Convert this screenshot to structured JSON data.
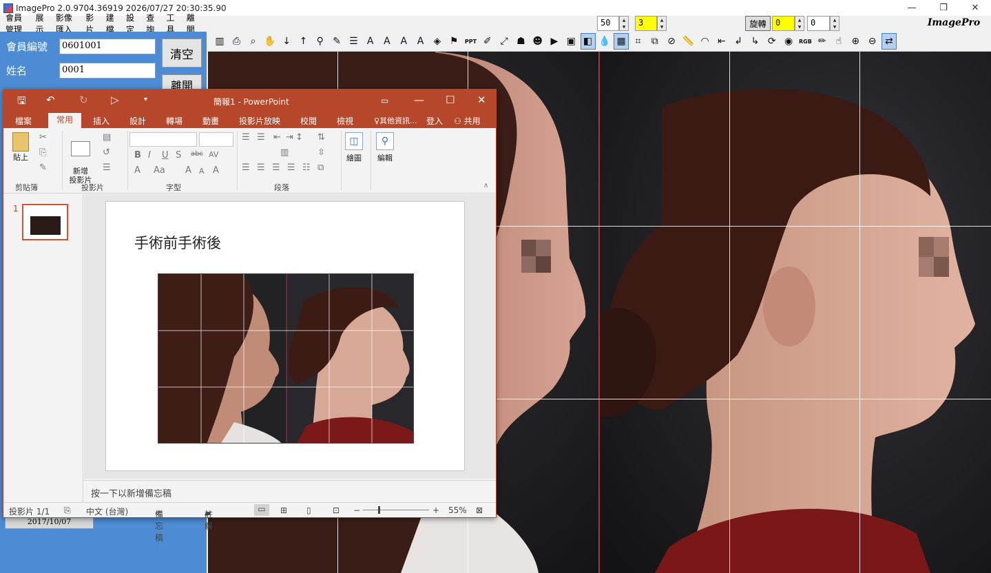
{
  "window": {
    "title": "ImagePro 2.0.9704.36919 2026/07/27 20:30:35.90",
    "minimize": "—",
    "restore": "❐",
    "close": "✕"
  },
  "menu": [
    "會員管理",
    "展示",
    "影像匯入",
    "影片",
    "建檔",
    "設定",
    "查詢",
    "工具",
    "離開"
  ],
  "controls": {
    "value_a": "50",
    "value_b": "3",
    "rotate_label": "旋轉",
    "rotate_value": "0",
    "value_c": "0",
    "brand": "ImagePro",
    "spin_up": "▲",
    "spin_down": "▼"
  },
  "toolbar": [
    {
      "icon": "layout-icon",
      "glyph": "▥"
    },
    {
      "icon": "export-icon",
      "glyph": "⎙"
    },
    {
      "icon": "ai-search-icon",
      "glyph": "⌕"
    },
    {
      "icon": "hand-icon",
      "glyph": "✋"
    },
    {
      "icon": "arrow-down-icon",
      "glyph": "↓"
    },
    {
      "icon": "arrow-up-icon",
      "glyph": "↑"
    },
    {
      "icon": "zoom-icon",
      "glyph": "⚲"
    },
    {
      "icon": "pen-icon",
      "glyph": "✎"
    },
    {
      "icon": "line-weight-icon",
      "glyph": "☰"
    },
    {
      "icon": "text-icon",
      "glyph": "A"
    },
    {
      "icon": "text-outline-icon",
      "glyph": "A"
    },
    {
      "icon": "text-search-icon",
      "glyph": "A"
    },
    {
      "icon": "underline-text-icon",
      "glyph": "A"
    },
    {
      "icon": "fill-icon",
      "glyph": "◈"
    },
    {
      "icon": "stamp-icon",
      "glyph": "⚑"
    },
    {
      "icon": "ppt-icon",
      "glyph": "PPT",
      "small": true
    },
    {
      "icon": "edit-doc-icon",
      "glyph": "✐"
    },
    {
      "icon": "fullscreen-icon",
      "glyph": "⤢"
    },
    {
      "icon": "portrait-icon",
      "glyph": "☗"
    },
    {
      "icon": "person-icon",
      "glyph": "☻"
    },
    {
      "icon": "play-icon",
      "glyph": "▶"
    },
    {
      "icon": "save-icon",
      "glyph": "▣"
    },
    {
      "icon": "compare-icon",
      "glyph": "◧",
      "selected": true
    },
    {
      "icon": "drop-icon",
      "glyph": "💧"
    },
    {
      "icon": "grid-icon",
      "glyph": "▦",
      "selected": true
    },
    {
      "icon": "crop-icon",
      "glyph": "⌗"
    },
    {
      "icon": "layers-icon",
      "glyph": "⧉"
    },
    {
      "icon": "cancel-icon",
      "glyph": "⊘"
    },
    {
      "icon": "ruler-icon",
      "glyph": "📏"
    },
    {
      "icon": "protractor-icon",
      "glyph": "◠"
    },
    {
      "icon": "back-icon",
      "glyph": "⇤"
    },
    {
      "icon": "turn-left-icon",
      "glyph": "↲"
    },
    {
      "icon": "turn-right-icon",
      "glyph": "↳"
    },
    {
      "icon": "camera-rotate-icon",
      "glyph": "⟳"
    },
    {
      "icon": "camera-icon",
      "glyph": "◉"
    },
    {
      "icon": "rgb-icon",
      "glyph": "RGB",
      "small": true
    },
    {
      "icon": "marker-icon",
      "glyph": "✏"
    },
    {
      "icon": "hand-pointer-icon",
      "glyph": "☝"
    },
    {
      "icon": "zoom-in-icon",
      "glyph": "⊕"
    },
    {
      "icon": "zoom-out-icon",
      "glyph": "⊖"
    },
    {
      "icon": "swap-icon",
      "glyph": "⇄",
      "selected": true
    }
  ],
  "member": {
    "id_label": "會員編號",
    "id_value": "0601001",
    "name_label": "姓名",
    "name_value": "0001",
    "clear_label": "清空",
    "exit_label": "離開",
    "date_item": "2017/10/07"
  },
  "ppt": {
    "doc_title": "簡報1 - PowerPoint",
    "tabs": [
      "檔案",
      "常用",
      "插入",
      "設計",
      "轉場",
      "動畫",
      "投影片放映",
      "校閱",
      "檢視",
      "其他資訊...",
      "登入",
      "共用"
    ],
    "groups": {
      "clipboard": "剪貼簿",
      "paste": "貼上",
      "slides": "投影片",
      "new_slide": "新增\n投影片",
      "font": "字型",
      "paragraph": "段落",
      "draw": "繪圖",
      "edit": "編輯"
    },
    "slide_number": "1",
    "slide_title": "手術前手術後",
    "notes_placeholder": "按一下以新增備忘稿",
    "status": {
      "slide_count": "投影片 1/1",
      "language": "中文 (台灣)",
      "notes": "備忘稿",
      "comments": "註解",
      "zoom": "55%"
    }
  },
  "colors": {
    "ppt_accent": "#b7472a",
    "panel_blue": "#4d8cd4",
    "highlight_yellow": "#ffff00"
  }
}
